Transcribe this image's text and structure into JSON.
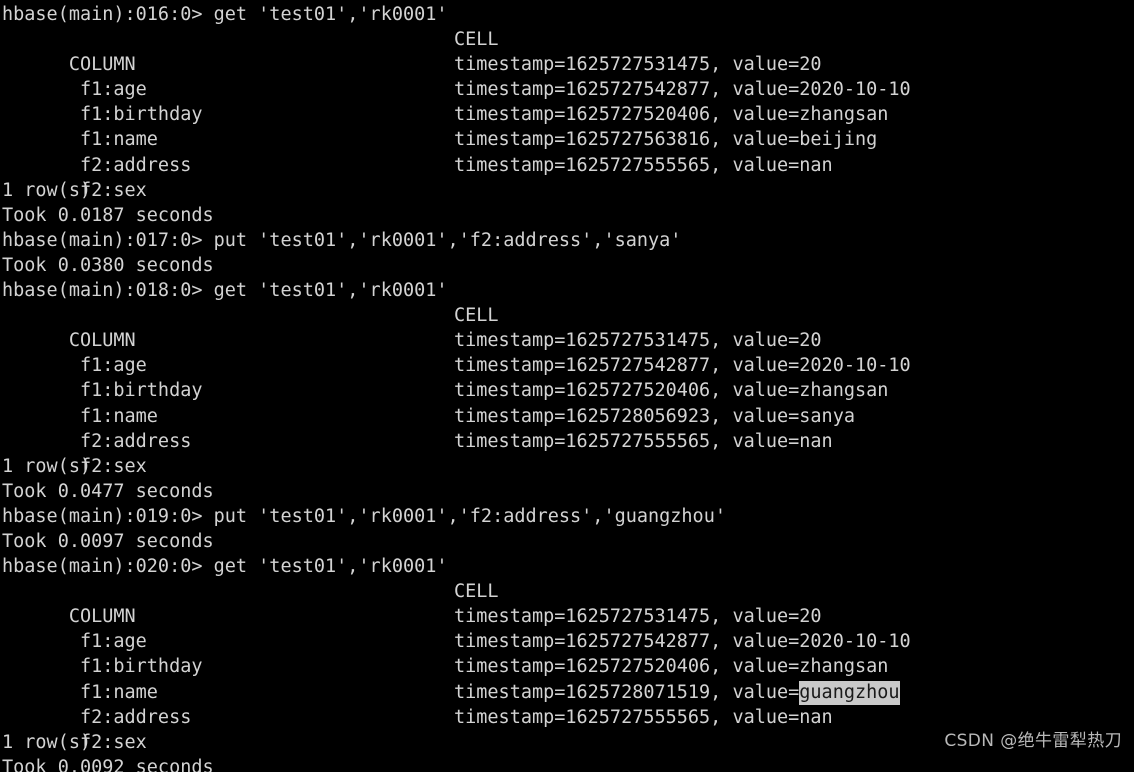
{
  "terminal": {
    "background_color": "#000000",
    "text_color": "#d3d3d3",
    "highlight_background_color": "#c9c9c9",
    "highlight_text_color": "#1a1a1a",
    "shell": "hbase shell",
    "column_header": "COLUMN",
    "cell_header": "CELL"
  },
  "blocks": [
    {
      "prompt": "hbase(main):016:0> get 'test01','rk0001'",
      "header_left": "COLUMN",
      "header_right": "CELL",
      "rows": [
        {
          "column": " f1:age",
          "cell": "timestamp=1625727531475, value=20"
        },
        {
          "column": " f1:birthday",
          "cell": "timestamp=1625727542877, value=2020-10-10"
        },
        {
          "column": " f1:name",
          "cell": "timestamp=1625727520406, value=zhangsan"
        },
        {
          "column": " f2:address",
          "cell": "timestamp=1625727563816, value=beijing"
        },
        {
          "column": " f2:sex",
          "cell": "timestamp=1625727555565, value=nan"
        }
      ],
      "row_count": "1 row(s)",
      "took": "Took 0.0187 seconds"
    },
    {
      "prompt": "hbase(main):017:0> put 'test01','rk0001','f2:address','sanya'",
      "took": "Took 0.0380 seconds"
    },
    {
      "prompt": "hbase(main):018:0> get 'test01','rk0001'",
      "header_left": "COLUMN",
      "header_right": "CELL",
      "rows": [
        {
          "column": " f1:age",
          "cell": "timestamp=1625727531475, value=20"
        },
        {
          "column": " f1:birthday",
          "cell": "timestamp=1625727542877, value=2020-10-10"
        },
        {
          "column": " f1:name",
          "cell": "timestamp=1625727520406, value=zhangsan"
        },
        {
          "column": " f2:address",
          "cell": "timestamp=1625728056923, value=sanya"
        },
        {
          "column": " f2:sex",
          "cell": "timestamp=1625727555565, value=nan"
        }
      ],
      "row_count": "1 row(s)",
      "took": "Took 0.0477 seconds"
    },
    {
      "prompt": "hbase(main):019:0> put 'test01','rk0001','f2:address','guangzhou'",
      "took": "Took 0.0097 seconds"
    },
    {
      "prompt": "hbase(main):020:0> get 'test01','rk0001'",
      "header_left": "COLUMN",
      "header_right": "CELL",
      "rows": [
        {
          "column": " f1:age",
          "cell": "timestamp=1625727531475, value=20"
        },
        {
          "column": " f1:birthday",
          "cell": "timestamp=1625727542877, value=2020-10-10"
        },
        {
          "column": " f1:name",
          "cell": "timestamp=1625727520406, value=zhangsan"
        },
        {
          "column": " f2:address",
          "cell_prefix": "timestamp=1625728071519, value=",
          "cell_selected": "guangzhou"
        },
        {
          "column": " f2:sex",
          "cell": "timestamp=1625727555565, value=nan"
        }
      ],
      "row_count": "1 row(s)",
      "took": "Took 0.0092 seconds"
    }
  ],
  "watermark": {
    "text": "CSDN @绝牛雷犁热刀"
  }
}
